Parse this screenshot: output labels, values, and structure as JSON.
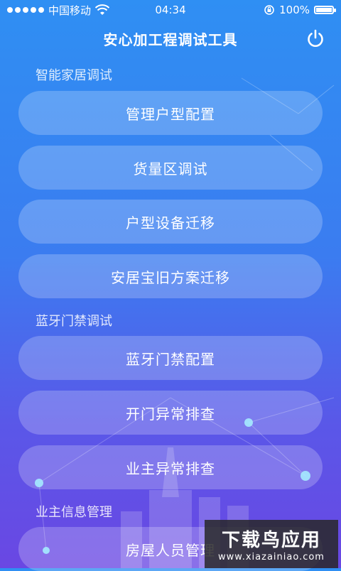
{
  "status_bar": {
    "carrier": "中国移动",
    "time": "04:34",
    "battery": "100%"
  },
  "header": {
    "title": "安心加工程调试工具",
    "power_icon": "power-icon"
  },
  "sections": [
    {
      "title": "智能家居调试",
      "buttons": [
        "管理户型配置",
        "货量区调试",
        "户型设备迁移",
        "安居宝旧方案迁移"
      ]
    },
    {
      "title": "蓝牙门禁调试",
      "buttons": [
        "蓝牙门禁配置",
        "开门异常排查",
        "业主异常排查"
      ]
    },
    {
      "title": "业主信息管理",
      "buttons": [
        "房屋人员管理"
      ]
    }
  ],
  "watermark": {
    "cn": "下载鸟应用",
    "en": "www.xiazainiao.com"
  },
  "colors": {
    "bg_top": "#2f8ff3",
    "bg_bottom": "#6a47e3"
  }
}
